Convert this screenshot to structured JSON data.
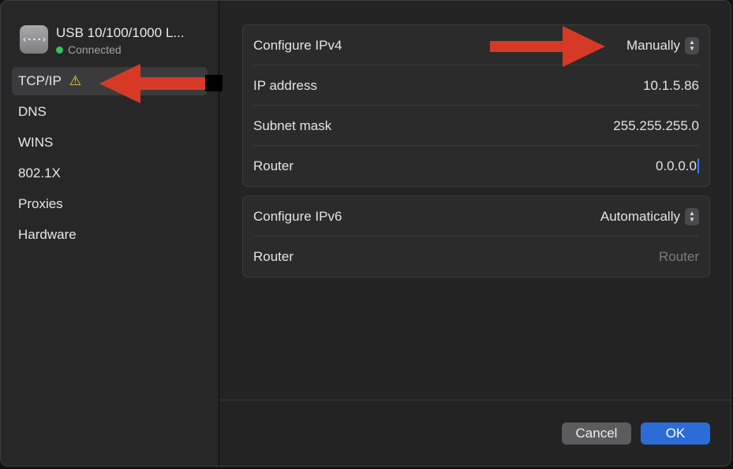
{
  "interface": {
    "name": "USB 10/100/1000 L...",
    "status": "Connected",
    "icon": "network-interface-icon",
    "icon_glyph": "‹···›"
  },
  "sidebar": {
    "items": [
      {
        "label": "TCP/IP",
        "selected": true,
        "warning": true
      },
      {
        "label": "DNS"
      },
      {
        "label": "WINS"
      },
      {
        "label": "802.1X"
      },
      {
        "label": "Proxies"
      },
      {
        "label": "Hardware"
      }
    ]
  },
  "ipv4": {
    "configure_label": "Configure IPv4",
    "configure_value": "Manually",
    "ip_label": "IP address",
    "ip_value": "10.1.5.86",
    "subnet_label": "Subnet mask",
    "subnet_value": "255.255.255.0",
    "router_label": "Router",
    "router_value": "0.0.0.0"
  },
  "ipv6": {
    "configure_label": "Configure IPv6",
    "configure_value": "Automatically",
    "router_label": "Router",
    "router_placeholder": "Router"
  },
  "buttons": {
    "cancel": "Cancel",
    "ok": "OK"
  },
  "colors": {
    "accent": "#2d6cd6",
    "status_connected": "#35c45a",
    "warning": "#f3d23b",
    "annotation_arrow": "#d63a26"
  }
}
